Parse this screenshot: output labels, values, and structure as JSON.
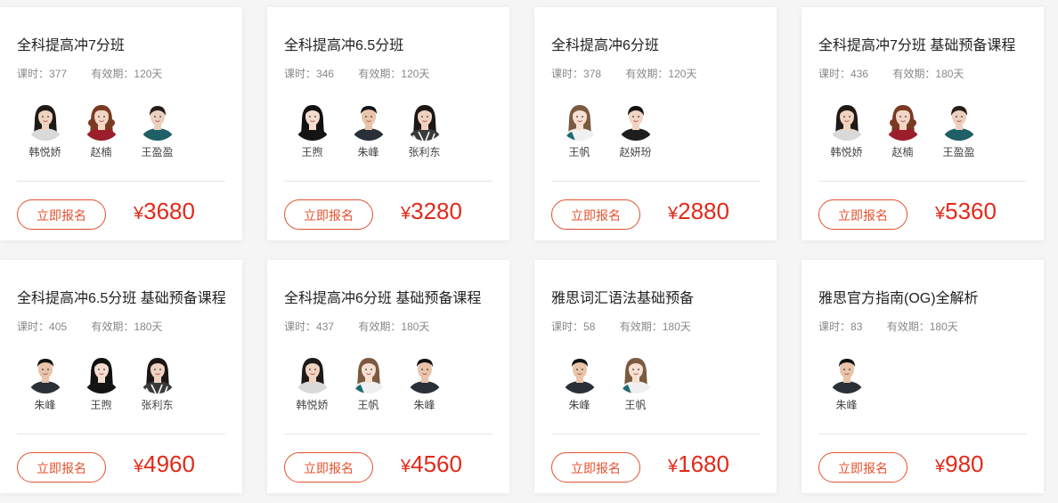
{
  "colors": {
    "accent": "#e4512e",
    "price": "#e02a1a",
    "background": "#f5f5f5",
    "card": "#ffffff"
  },
  "labels": {
    "lessons_prefix": "课时：",
    "valid_prefix": "有效期：",
    "enroll": "立即报名",
    "currency": "¥"
  },
  "courses": [
    {
      "title": "全科提高冲7分班",
      "lessons": "377",
      "valid": "120天",
      "price": "3680",
      "teachers": [
        {
          "name": "韩悦娇",
          "look": "f-long-dark"
        },
        {
          "name": "赵楠",
          "look": "f-curly-red"
        },
        {
          "name": "王盈盈",
          "look": "f-teal"
        }
      ]
    },
    {
      "title": "全科提高冲6.5分班",
      "lessons": "346",
      "valid": "120天",
      "price": "3280",
      "teachers": [
        {
          "name": "王煦",
          "look": "f-black"
        },
        {
          "name": "朱峰",
          "look": "m-dark"
        },
        {
          "name": "张利东",
          "look": "f-stripe"
        }
      ]
    },
    {
      "title": "全科提高冲6分班",
      "lessons": "378",
      "valid": "120天",
      "price": "2880",
      "teachers": [
        {
          "name": "王帆",
          "look": "f-light"
        },
        {
          "name": "赵妍玢",
          "look": "f-short"
        }
      ]
    },
    {
      "title": "全科提高冲7分班 基础预备课程",
      "lessons": "436",
      "valid": "180天",
      "price": "5360",
      "teachers": [
        {
          "name": "韩悦娇",
          "look": "f-long-dark"
        },
        {
          "name": "赵楠",
          "look": "f-curly-red"
        },
        {
          "name": "王盈盈",
          "look": "f-teal"
        }
      ]
    },
    {
      "title": "全科提高冲6.5分班 基础预备课程",
      "lessons": "405",
      "valid": "180天",
      "price": "4960",
      "teachers": [
        {
          "name": "朱峰",
          "look": "m-dark"
        },
        {
          "name": "王煦",
          "look": "f-black"
        },
        {
          "name": "张利东",
          "look": "f-stripe"
        }
      ]
    },
    {
      "title": "全科提高冲6分班 基础预备课程",
      "lessons": "437",
      "valid": "180天",
      "price": "4560",
      "teachers": [
        {
          "name": "韩悦娇",
          "look": "f-long-dark"
        },
        {
          "name": "王帆",
          "look": "f-light"
        },
        {
          "name": "朱峰",
          "look": "m-dark"
        }
      ]
    },
    {
      "title": "雅思词汇语法基础预备",
      "lessons": "58",
      "valid": "180天",
      "price": "1680",
      "teachers": [
        {
          "name": "朱峰",
          "look": "m-dark"
        },
        {
          "name": "王帆",
          "look": "f-light"
        }
      ]
    },
    {
      "title": "雅思官方指南(OG)全解析",
      "lessons": "83",
      "valid": "180天",
      "price": "980",
      "teachers": [
        {
          "name": "朱峰",
          "look": "m-dark"
        }
      ]
    }
  ]
}
